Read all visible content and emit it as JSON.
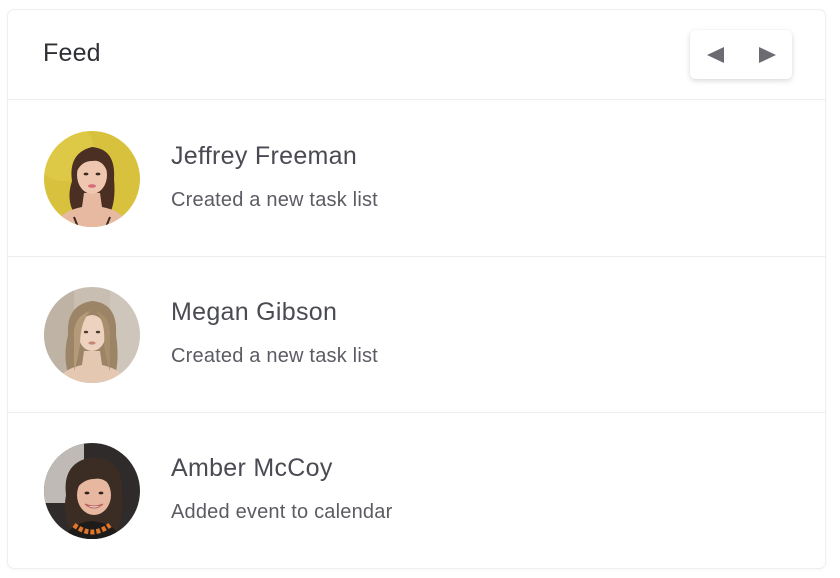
{
  "header": {
    "title": "Feed",
    "prev_icon": "triangle-left-icon",
    "next_icon": "triangle-right-icon"
  },
  "feed": {
    "items": [
      {
        "name": "Jeffrey Freeman",
        "action": "Created a new task list",
        "avatar_bg": "#d9c23c"
      },
      {
        "name": "Megan Gibson",
        "action": "Created a new task list",
        "avatar_bg": "#c9bfb3"
      },
      {
        "name": "Amber McCoy",
        "action": "Added event to calendar",
        "avatar_bg": "#3a3533"
      }
    ]
  },
  "colors": {
    "text_primary": "#2f3036",
    "text_secondary": "#5b5c63",
    "divider": "#ebecee",
    "pager_arrow": "#6b6c72"
  }
}
